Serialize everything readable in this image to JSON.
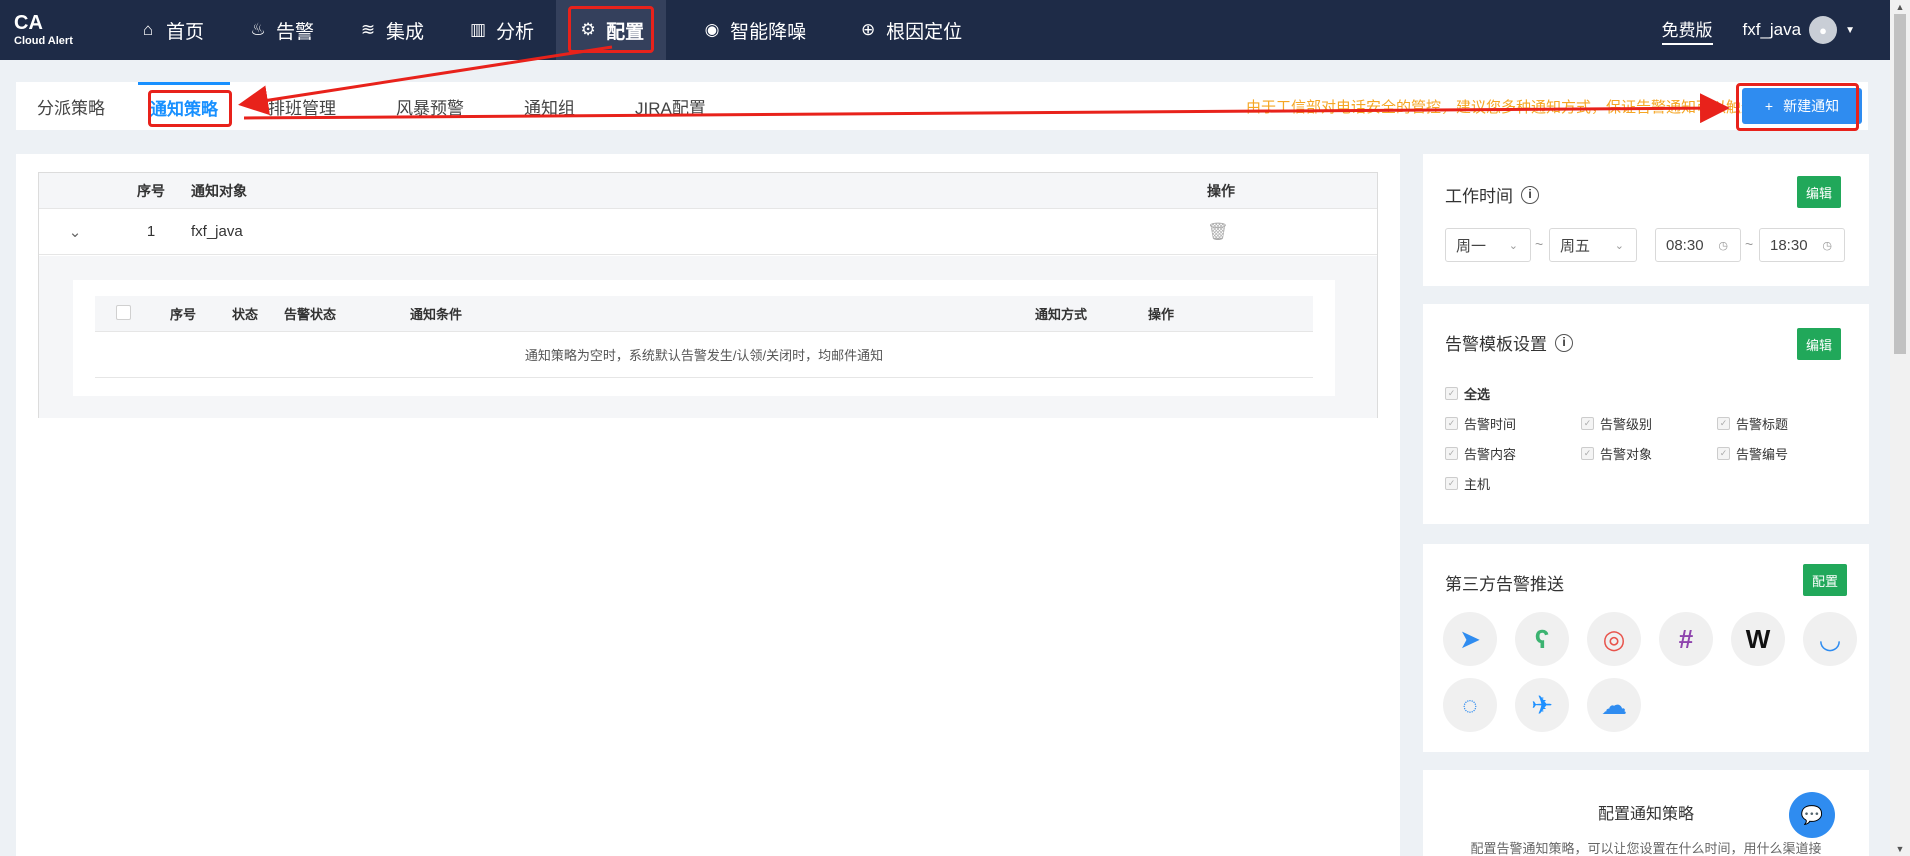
{
  "header": {
    "logo_line1": "CA",
    "logo_line2": "Cloud Alert",
    "nav": [
      {
        "label": "首页",
        "icon": "home-icon"
      },
      {
        "label": "告警",
        "icon": "alarm-icon"
      },
      {
        "label": "集成",
        "icon": "layers-icon"
      },
      {
        "label": "分析",
        "icon": "chart-icon"
      },
      {
        "label": "配置",
        "icon": "gear-icon"
      },
      {
        "label": "智能降噪",
        "icon": "noise-icon"
      },
      {
        "label": "根因定位",
        "icon": "target-icon"
      }
    ],
    "free_label": "免费版",
    "username": "fxf_java"
  },
  "tabs": [
    {
      "label": "分派策略"
    },
    {
      "label": "通知策略"
    },
    {
      "label": "排班管理"
    },
    {
      "label": "风暴预警"
    },
    {
      "label": "通知组"
    },
    {
      "label": "JIRA配置"
    }
  ],
  "notice_text": "由于工信部对电话安全的管控，建议您多种通知方式，保证告警通知可以触达",
  "new_button_label": "新建通知",
  "table": {
    "headers": {
      "no": "序号",
      "target": "通知对象",
      "op": "操作"
    },
    "rows": [
      {
        "no": "1",
        "target": "fxf_java"
      }
    ],
    "inner_headers": {
      "no": "序号",
      "status": "状态",
      "alert_status": "告警状态",
      "condition": "通知条件",
      "method": "通知方式",
      "op": "操作"
    },
    "empty_text": "通知策略为空时，系统默认告警发生/认领/关闭时，均邮件通知"
  },
  "work_time": {
    "title": "工作时间",
    "edit_label": "编辑",
    "day_from": "周一",
    "day_to": "周五",
    "time_from": "08:30",
    "time_to": "18:30"
  },
  "template": {
    "title": "告警模板设置",
    "edit_label": "编辑",
    "select_all": "全选",
    "items": [
      "告警时间",
      "告警级别",
      "告警标题",
      "告警内容",
      "告警对象",
      "告警编号",
      "主机"
    ]
  },
  "third_party": {
    "title": "第三方告警推送",
    "config_label": "配置",
    "icons": [
      "dingtalk-icon",
      "bear-icon",
      "feishu-icon",
      "slack-icon",
      "wechat-work-w-icon",
      "smile-icon",
      "chat-bubble-icon",
      "paper-plane-icon",
      "cloud-icon"
    ]
  },
  "help_card": {
    "title": "配置通知策略",
    "desc": "配置告警通知策略，可以让您设置在什么时间，用什么渠道接"
  },
  "colors": {
    "nav_bg": "#1e2b47",
    "primary": "#2f8cf0",
    "green": "#21a85a",
    "annotation_red": "#e8221b",
    "notice": "#f5a623"
  }
}
